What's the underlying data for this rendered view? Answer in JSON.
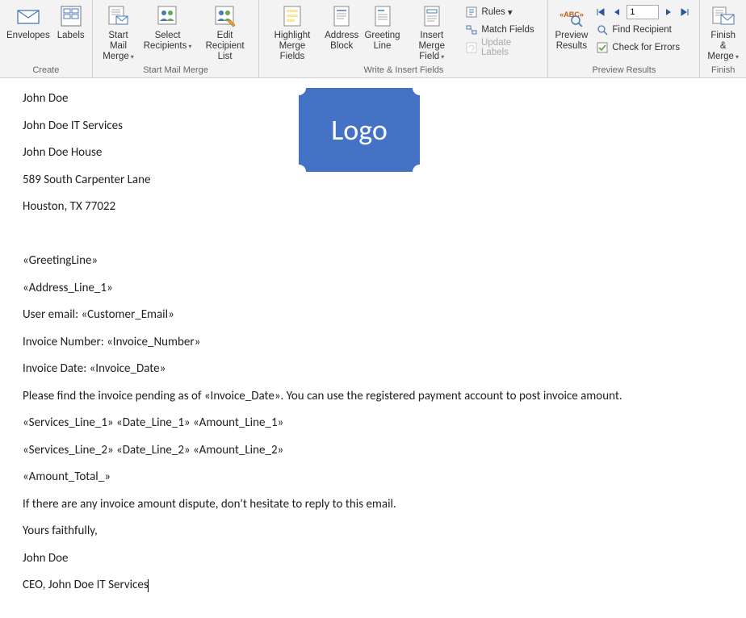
{
  "ribbon": {
    "groups": {
      "create": {
        "label": "Create",
        "envelopes": "Envelopes",
        "labels": "Labels"
      },
      "start": {
        "label": "Start Mail Merge",
        "start_merge": "Start Mail\nMerge",
        "select_recipients": "Select\nRecipients",
        "edit_list": "Edit\nRecipient List"
      },
      "fields": {
        "label": "Write & Insert Fields",
        "highlight": "Highlight\nMerge Fields",
        "address_block": "Address\nBlock",
        "greeting_line": "Greeting\nLine",
        "insert_field": "Insert Merge\nField",
        "rules": "Rules",
        "match": "Match Fields",
        "update": "Update Labels"
      },
      "preview": {
        "label": "Preview Results",
        "preview_results": "Preview\nResults",
        "record": "1",
        "find_recipient": "Find Recipient",
        "check_errors": "Check for Errors"
      },
      "finish": {
        "label": "Finish",
        "finish_merge": "Finish &\nMerge"
      }
    }
  },
  "logo": {
    "text": "Logo"
  },
  "document": {
    "sender_name": "John Doe",
    "sender_company": "John Doe IT Services",
    "sender_building": "John Doe House",
    "sender_street": "589 South Carpenter Lane",
    "sender_city": "Houston, TX 77022",
    "greeting_field": "«GreetingLine»",
    "address_field": "«Address_Line_1»",
    "email_line": "User email: «Customer_Email»",
    "invoice_num": "Invoice Number: «Invoice_Number»",
    "invoice_date": "Invoice Date: «Invoice_Date»",
    "body_intro": "Please find the invoice pending as of «Invoice_Date». You can use the registered payment account to post invoice amount.",
    "line1": "«Services_Line_1» «Date_Line_1» «Amount_Line_1»",
    "line2": "«Services_Line_2» «Date_Line_2» «Amount_Line_2»",
    "total": "«Amount_Total_»",
    "dispute": "If there are any invoice amount dispute, don't hesitate to reply to this email.",
    "closing": "Yours faithfully,",
    "sig_name": "John Doe",
    "sig_title": "CEO, John Doe IT Services"
  }
}
